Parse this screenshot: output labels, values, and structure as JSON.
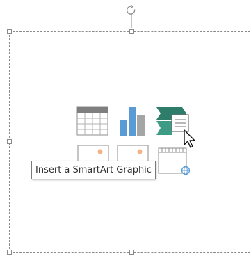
{
  "tooltip": {
    "text": "Insert a SmartArt Graphic"
  },
  "content_icons": [
    {
      "name": "insert-table-icon",
      "label": ""
    },
    {
      "name": "insert-chart-icon",
      "label": ""
    },
    {
      "name": "insert-smartart-icon",
      "label": ""
    },
    {
      "name": "pictures-icon",
      "label": ""
    },
    {
      "name": "online-pictures-icon",
      "label": ""
    },
    {
      "name": "insert-video-icon",
      "label": ""
    }
  ],
  "colors": {
    "frame_border": "#8a8a8a",
    "table_header": "#7f7f7f",
    "chart_blue": "#5b9bd5",
    "chart_gray": "#a5a5a5",
    "smartart_green": "#2e7d6b",
    "picture_orange": "#f4b183",
    "online_blue": "#5b9bd5",
    "tooltip_border": "#7a7a7a"
  }
}
